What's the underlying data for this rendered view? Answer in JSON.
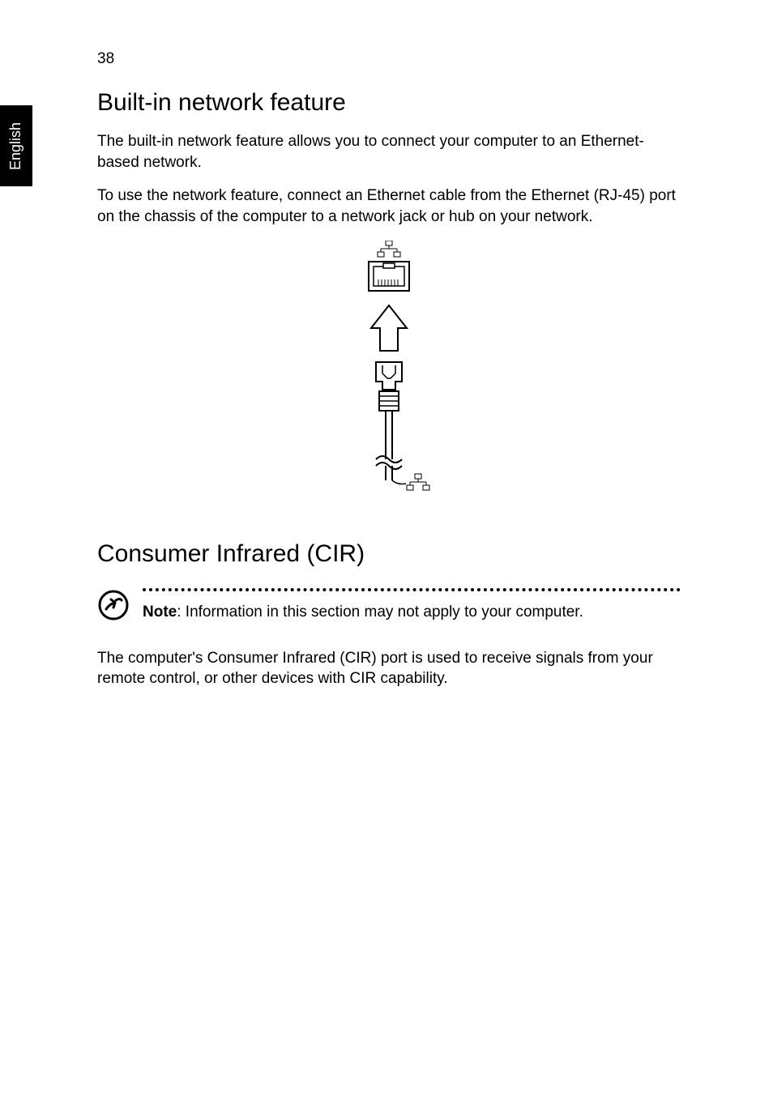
{
  "page_number": "38",
  "side_tab": "English",
  "section1": {
    "title": "Built-in network feature",
    "p1": "The built-in network feature allows you to connect your computer to an Ethernet-based network.",
    "p2": "To use the network feature, connect an Ethernet cable from the Ethernet (RJ-45) port on the chassis of the computer to a network jack or hub on your network."
  },
  "section2": {
    "title": "Consumer Infrared (CIR)",
    "note_label": "Note",
    "note_text": ": Information in this section may not apply to your computer.",
    "p1": "The computer's Consumer Infrared (CIR) port is used to receive signals from your remote control, or other devices with CIR capability."
  }
}
